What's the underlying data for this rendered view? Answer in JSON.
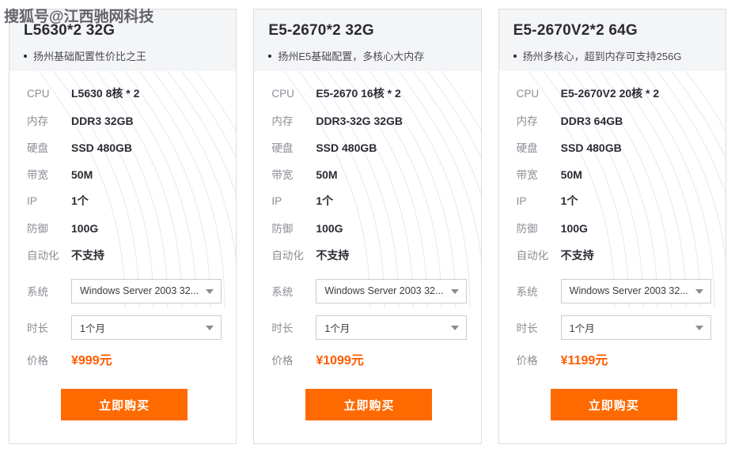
{
  "watermark": {
    "text": "搜狐号@江西驰网科技"
  },
  "colors": {
    "accent_orange": "#ff6a00",
    "price_orange": "#ff5a00",
    "header_band": "#f4f5f7",
    "card_border": "#dcdcdc",
    "label_gray": "#8d8d96",
    "value_dark": "#2b2b33"
  },
  "labels": {
    "cpu": "CPU",
    "memory": "内存",
    "disk": "硬盘",
    "bandwidth": "带宽",
    "ip": "IP",
    "defense": "防御",
    "automation": "自动化",
    "system": "系统",
    "duration": "时长",
    "price": "价格"
  },
  "buy_label": "立即购买",
  "cards": [
    {
      "title": "L5630*2 32G",
      "subtitle": "扬州基础配置性价比之王",
      "cpu": "L5630 8核 * 2",
      "memory": "DDR3 32GB",
      "disk": "SSD 480GB",
      "bandwidth": "50M",
      "ip": "1个",
      "defense": "100G",
      "automation": "不支持",
      "system": "Windows Server 2003 32...",
      "duration": "1个月",
      "price": "¥999元"
    },
    {
      "title": "E5-2670*2 32G",
      "subtitle": "扬州E5基础配置，多核心大内存",
      "cpu": "E5-2670 16核 * 2",
      "memory": "DDR3-32G 32GB",
      "disk": "SSD 480GB",
      "bandwidth": "50M",
      "ip": "1个",
      "defense": "100G",
      "automation": "不支持",
      "system": "Windows Server 2003 32...",
      "duration": "1个月",
      "price": "¥1099元"
    },
    {
      "title": "E5-2670V2*2 64G",
      "subtitle": "扬州多核心，超到内存可支持256G",
      "cpu": "E5-2670V2 20核 * 2",
      "memory": "DDR3 64GB",
      "disk": "SSD 480GB",
      "bandwidth": "50M",
      "ip": "1个",
      "defense": "100G",
      "automation": "不支持",
      "system": "Windows Server 2003 32...",
      "duration": "1个月",
      "price": "¥1199元"
    }
  ]
}
